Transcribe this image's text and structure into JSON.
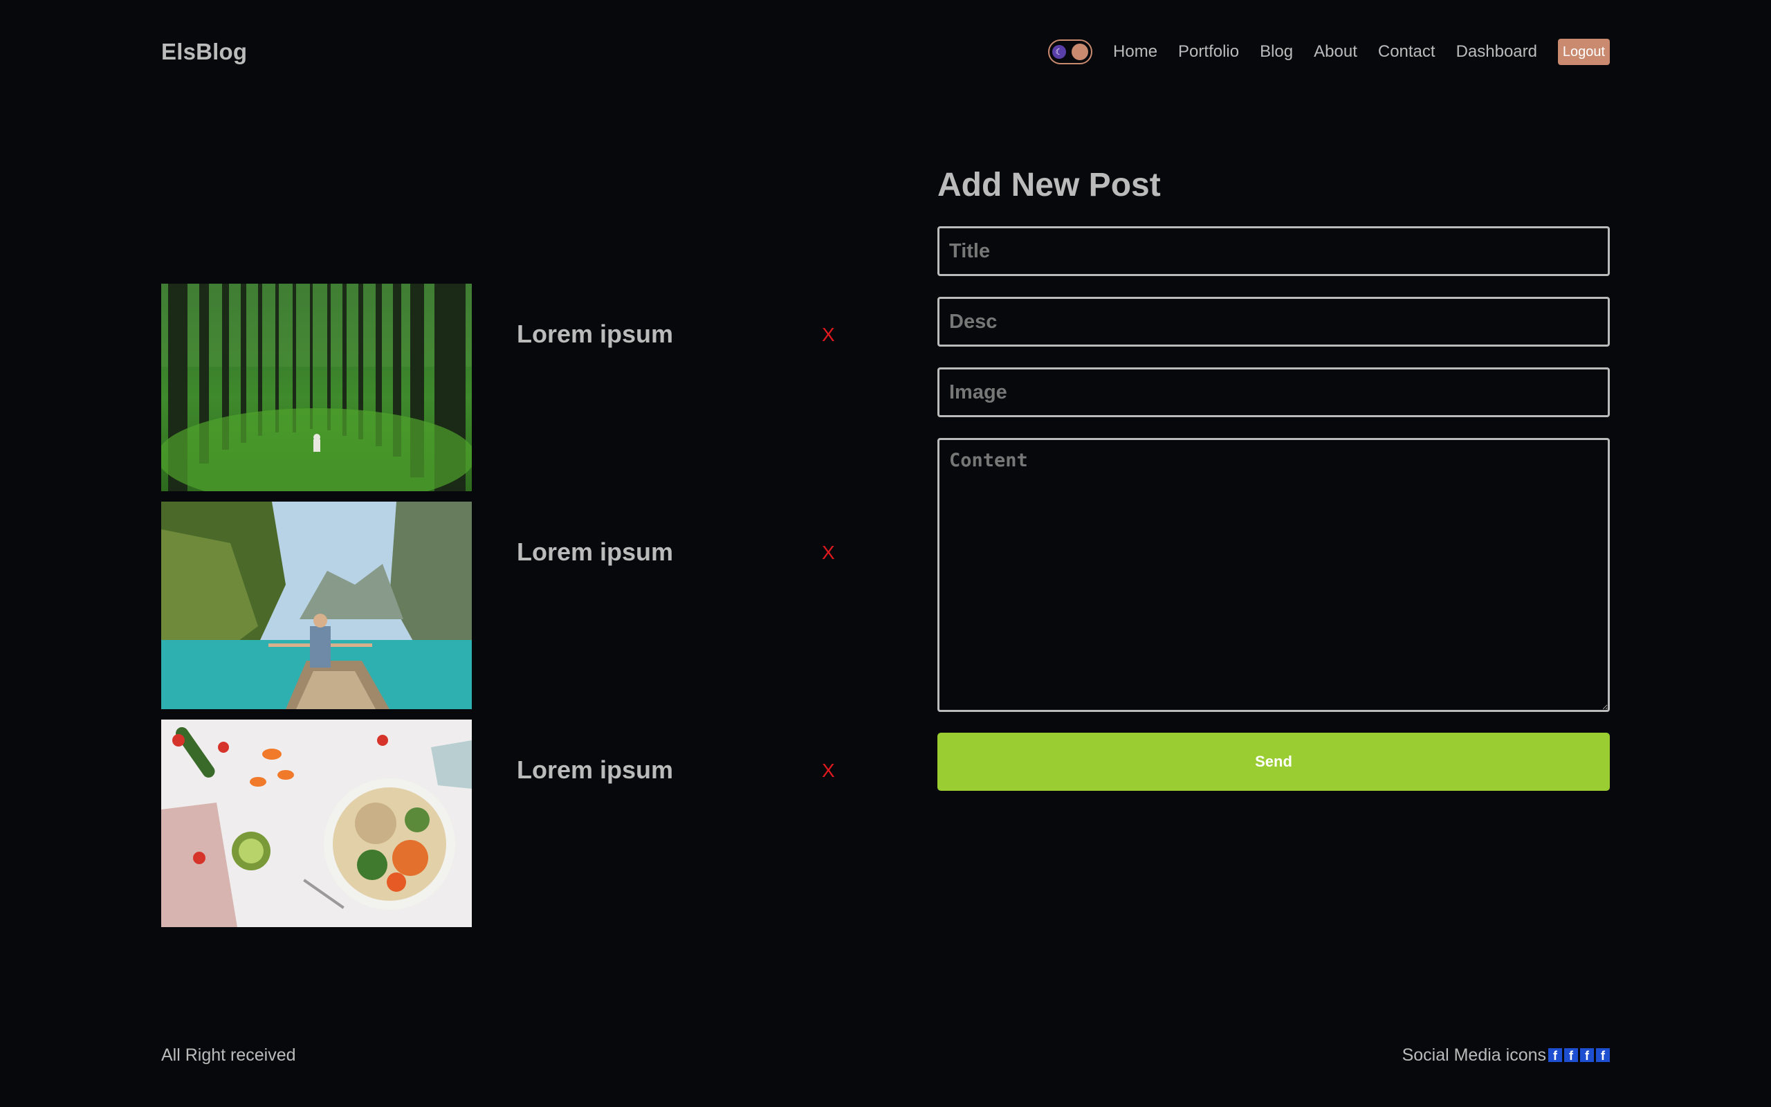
{
  "header": {
    "logo": "ElsBlog",
    "nav": [
      "Home",
      "Portfolio",
      "Blog",
      "About",
      "Contact",
      "Dashboard"
    ],
    "logout_label": "Logout",
    "theme_toggle_icon": "moon-icon"
  },
  "posts": [
    {
      "title": "Lorem ipsum",
      "image": "forest-image",
      "delete_label": "X"
    },
    {
      "title": "Lorem ipsum",
      "image": "boat-lake-image",
      "delete_label": "X"
    },
    {
      "title": "Lorem ipsum",
      "image": "salad-bowl-image",
      "delete_label": "X"
    }
  ],
  "form": {
    "heading": "Add New Post",
    "title_placeholder": "Title",
    "desc_placeholder": "Desc",
    "image_placeholder": "Image",
    "content_placeholder": "Content",
    "send_label": "Send"
  },
  "footer": {
    "copyright": "All Right received",
    "social_label": "Social Media icons",
    "social_icons": [
      "facebook-icon",
      "facebook-icon",
      "facebook-icon",
      "facebook-icon"
    ]
  },
  "colors": {
    "background": "#07080c",
    "text": "#bbbbbb",
    "accent": "#c98a6f",
    "send": "#9acd32",
    "delete": "#e0191e",
    "social": "#1f4fd1"
  }
}
